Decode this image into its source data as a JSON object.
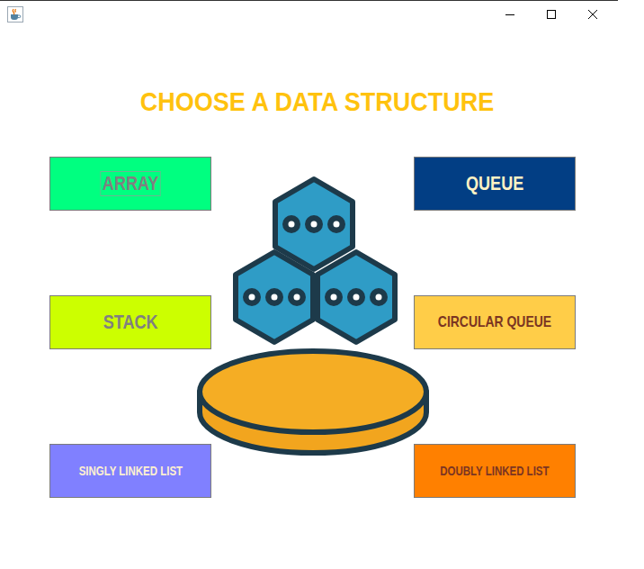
{
  "heading": "CHOOSE A DATA STRUCTURE",
  "buttons": [
    {
      "label": "ARRAY",
      "color": "#00ff80",
      "text_color": "#808080",
      "focused": true
    },
    {
      "label": "QUEUE",
      "color": "#023e84",
      "text_color": "#fff2c4",
      "focused": false
    },
    {
      "label": "STACK",
      "color": "#ccff00",
      "text_color": "#808080",
      "focused": false
    },
    {
      "label": "CIRCULAR QUEUE",
      "color": "#ffcd48",
      "text_color": "#7b3522",
      "focused": false
    },
    {
      "label": "SINGLY LINKED LIST",
      "color": "#8080ff",
      "text_color": "#fff0d0",
      "focused": false
    },
    {
      "label": "DOUBLY LINKED LIST",
      "color": "#ff8000",
      "text_color": "#7b3522",
      "focused": false
    }
  ]
}
